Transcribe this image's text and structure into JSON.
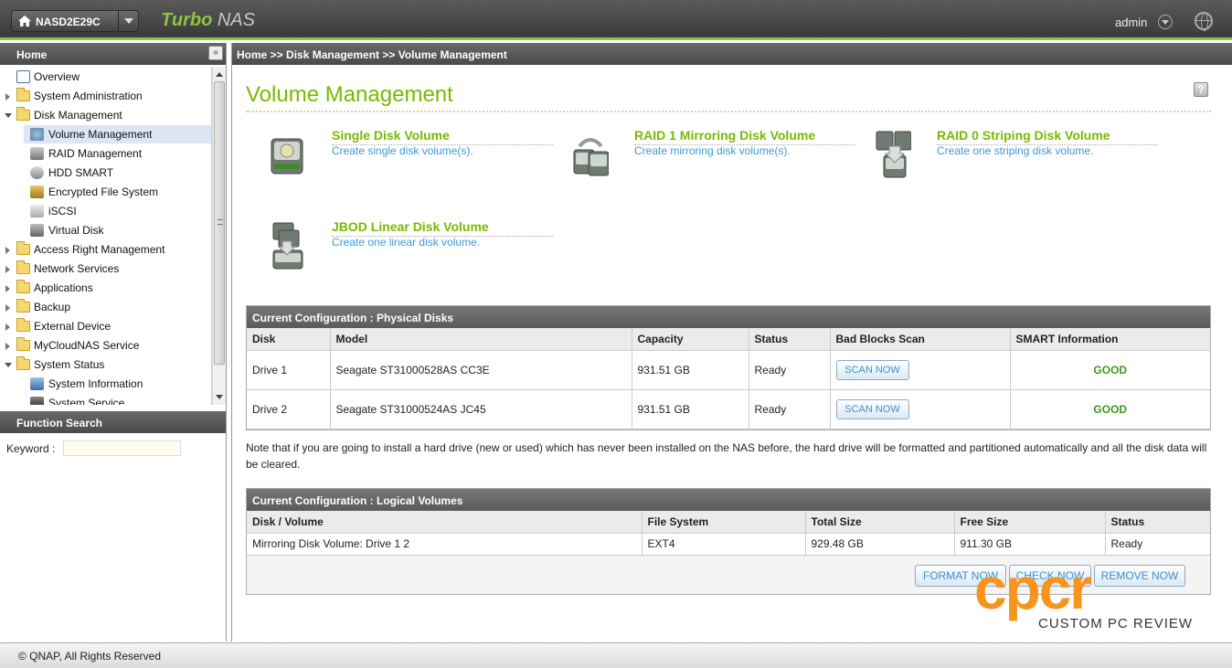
{
  "topbar": {
    "device_name": "NASD2E29C",
    "brand_prefix": "Turbo",
    "brand_suffix": "NAS",
    "user": "admin",
    "accent_color": "#8dc63f"
  },
  "sidebar": {
    "header": "Home",
    "collapse_glyph": "«",
    "items": [
      {
        "label": "Overview",
        "icon": "overview-icon"
      },
      {
        "label": "System Administration",
        "icon": "folder-icon"
      },
      {
        "label": "Disk Management",
        "icon": "folder-icon"
      },
      {
        "label": "Volume Management",
        "icon": "volume-icon"
      },
      {
        "label": "RAID Management",
        "icon": "raid-icon"
      },
      {
        "label": "HDD SMART",
        "icon": "smart-icon"
      },
      {
        "label": "Encrypted File System",
        "icon": "encryption-icon"
      },
      {
        "label": "iSCSI",
        "icon": "iscsi-icon"
      },
      {
        "label": "Virtual Disk",
        "icon": "virtual-disk-icon"
      },
      {
        "label": "Access Right Management",
        "icon": "folder-icon"
      },
      {
        "label": "Network Services",
        "icon": "folder-icon"
      },
      {
        "label": "Applications",
        "icon": "folder-icon"
      },
      {
        "label": "Backup",
        "icon": "folder-icon"
      },
      {
        "label": "External Device",
        "icon": "folder-icon"
      },
      {
        "label": "MyCloudNAS Service",
        "icon": "folder-icon"
      },
      {
        "label": "System Status",
        "icon": "folder-icon"
      },
      {
        "label": "System Information",
        "icon": "system-info-icon"
      },
      {
        "label": "System Service",
        "icon": "system-service-icon"
      }
    ],
    "function_search": {
      "header": "Function Search",
      "keyword_label": "Keyword :",
      "keyword_value": ""
    }
  },
  "breadcrumb": "Home >> Disk Management >> Volume Management",
  "main": {
    "title": "Volume Management",
    "help_glyph": "?",
    "options": [
      {
        "title": "Single Disk Volume",
        "desc": "Create single disk volume(s)."
      },
      {
        "title": "RAID 1 Mirroring Disk Volume",
        "desc": "Create mirroring disk volume(s)."
      },
      {
        "title": "RAID 0 Striping Disk Volume",
        "desc": "Create one striping disk volume."
      },
      {
        "title": "JBOD Linear Disk Volume",
        "desc": "Create one linear disk volume."
      }
    ],
    "physical": {
      "title": "Current Configuration : Physical Disks",
      "headers": [
        "Disk",
        "Model",
        "Capacity",
        "Status",
        "Bad Blocks Scan",
        "SMART Information"
      ],
      "rows": [
        {
          "disk": "Drive 1",
          "model": "Seagate ST31000528AS CC3E",
          "capacity": "931.51 GB",
          "status": "Ready",
          "scan": "SCAN NOW",
          "smart": "GOOD"
        },
        {
          "disk": "Drive 2",
          "model": "Seagate ST31000524AS JC45",
          "capacity": "931.51 GB",
          "status": "Ready",
          "scan": "SCAN NOW",
          "smart": "GOOD"
        }
      ]
    },
    "note": "Note that if you are going to install a hard drive (new or used) which has never been installed on the NAS before, the hard drive will be formatted and partitioned automatically and all the disk data will be cleared.",
    "logical": {
      "title": "Current Configuration : Logical Volumes",
      "headers": [
        "Disk / Volume",
        "File System",
        "Total Size",
        "Free Size",
        "Status"
      ],
      "rows": [
        {
          "volume": "Mirroring Disk Volume: Drive 1 2",
          "fs": "EXT4",
          "total": "929.48 GB",
          "free": "911.30 GB",
          "status": "Ready"
        }
      ],
      "actions": [
        "FORMAT NOW",
        "CHECK NOW",
        "REMOVE NOW"
      ]
    }
  },
  "watermark": {
    "letters": "cpcr",
    "caption": "CUSTOM PC REVIEW",
    "color": "#f7941d"
  },
  "footer": "© QNAP, All Rights Reserved"
}
